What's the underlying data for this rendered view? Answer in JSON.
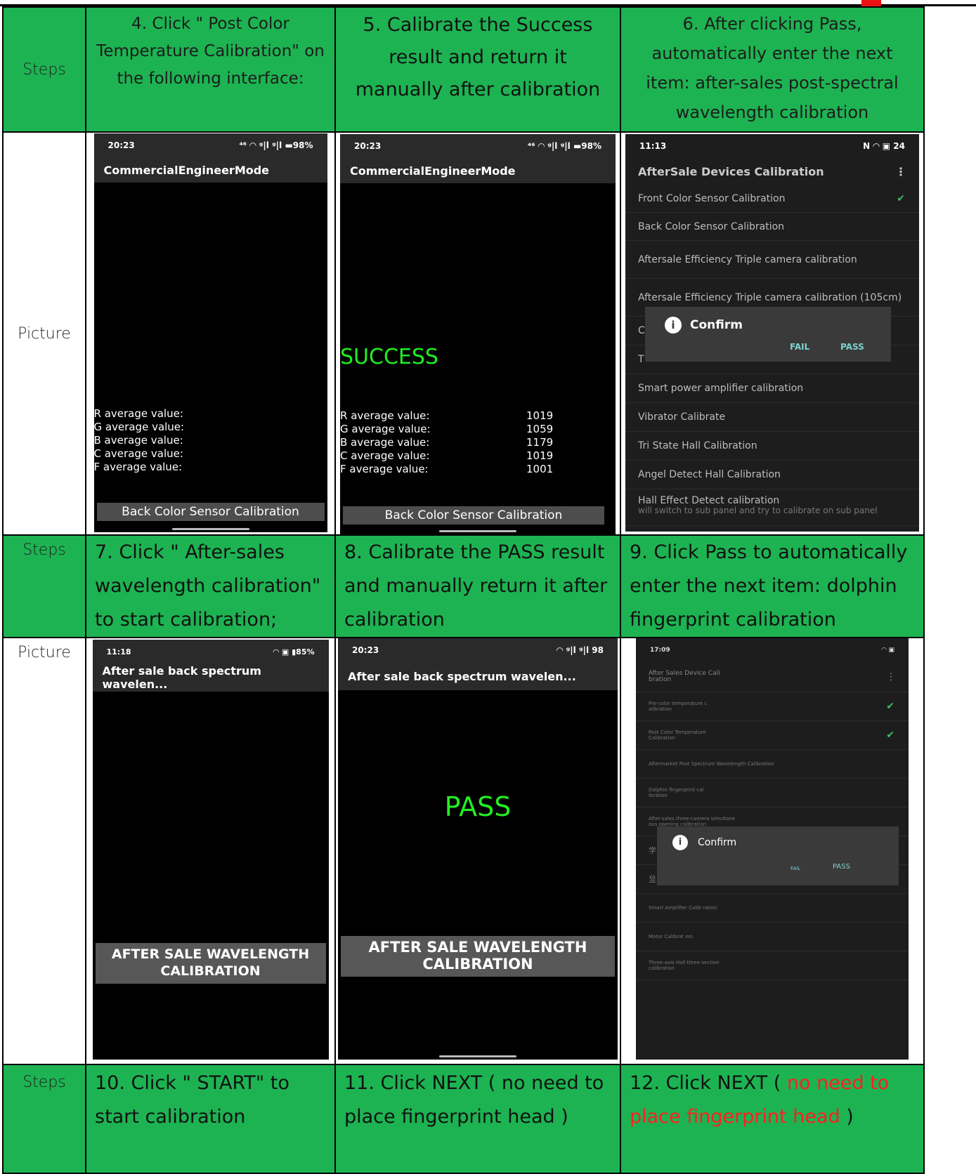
{
  "labels": {
    "steps": "Steps",
    "picture": "Picture"
  },
  "row1": {
    "s4": "4. Click \" Post Color Temperature Calibration\" on the following interface:",
    "s5": "5. Calibrate the Success result and return it manually after calibration",
    "s6": "6. After clicking Pass, automatically enter the next item: after-sales post-spectral wavelength calibration"
  },
  "shot1": {
    "time": "20:23",
    "status": "⁴⁶ ◠ ᵍ|l ᵍ|l ▬98%",
    "title": "CommercialEngineerMode",
    "keys": [
      "R average value:",
      "G average value:",
      "B average value:",
      "C average value:",
      "F average value:"
    ],
    "button": "Back Color Sensor Calibration"
  },
  "shot2": {
    "time": "20:23",
    "status": "⁴⁶ ◠ ᵍ|l ᵍ|l ▬98%",
    "title": "CommercialEngineerMode",
    "result": "SUCCESS",
    "keys": [
      "R average value:",
      "G average value:",
      "B average value:",
      "C average value:",
      "F average value:"
    ],
    "values": [
      "1019",
      "1059",
      "1179",
      "1019",
      "1001"
    ],
    "button": "Back Color Sensor Calibration"
  },
  "shot3": {
    "time": "11:13",
    "status": "N ◠ ▣ 24",
    "title": "AfterSale Devices Calibration",
    "items": [
      "Front Color Sensor Calibration",
      "Back Color Sensor Calibration",
      "Aftersale Efficiency Triple camera calibration",
      "Aftersale Efficiency Triple camera calibration (105cm)",
      "C",
      "T",
      "Smart power amplifier calibration",
      "Vibrator Calibrate",
      "Tri State Hall Calibration",
      "Angel Detect Hall Calibration",
      "Hall Effect Detect calibration"
    ],
    "last_sub": "will switch to sub panel and try to calibrate on sub panel",
    "dialog_title": "Confirm",
    "fail": "FAIL",
    "pass": "PASS"
  },
  "row2": {
    "s7": "7. Click \" After-sales wavelength calibration\" to start calibration;",
    "s8": "8. Calibrate the PASS result and manually return it after calibration",
    "s9": "9. Click Pass to automatically enter the next item: dolphin fingerprint calibration"
  },
  "shot4": {
    "time": "11:18",
    "status": "◠ ▣ ▮85%",
    "title": "After sale back spectrum wavelen...",
    "button": "AFTER SALE WAVELENGTH CALIBRATION"
  },
  "shot5": {
    "time": "20:23",
    "status": "◠ ᵍ|l ᵍ|l 98",
    "title": "After sale back spectrum wavelen...",
    "result": "PASS",
    "button": "AFTER SALE WAVELENGTH CALIBRATION"
  },
  "shot6": {
    "time": "17:09",
    "title": "After Sales Device Cali bration",
    "items": [
      "Pre-color temperature c alibration",
      "Post Color Temperature Calibration",
      "Aftermarket Post Spectrum Wavelength Calibration",
      "Dolphin fingerprint cal ibration",
      "After-sales three-camera simultane ous opening calibration",
      "学",
      "显",
      "Smart Amplifier Calib ration",
      "Motor Calibrat ion",
      "Three-axis Hall three-section calibration"
    ],
    "dialog_title": "Confirm",
    "fail": "FAIL",
    "pass": "PASS"
  },
  "row3": {
    "s10": "10. Click \" START\" to start calibration",
    "s11": "11. Click NEXT ( no need to place fingerprint head )",
    "s12_a": "12. Click NEXT ( ",
    "s12_red": "no need to place fingerprint head",
    "s12_b": " )"
  },
  "colors": {
    "header_green": "#1db352",
    "success_green": "#22ee22",
    "warning_red": "#ff2020"
  }
}
